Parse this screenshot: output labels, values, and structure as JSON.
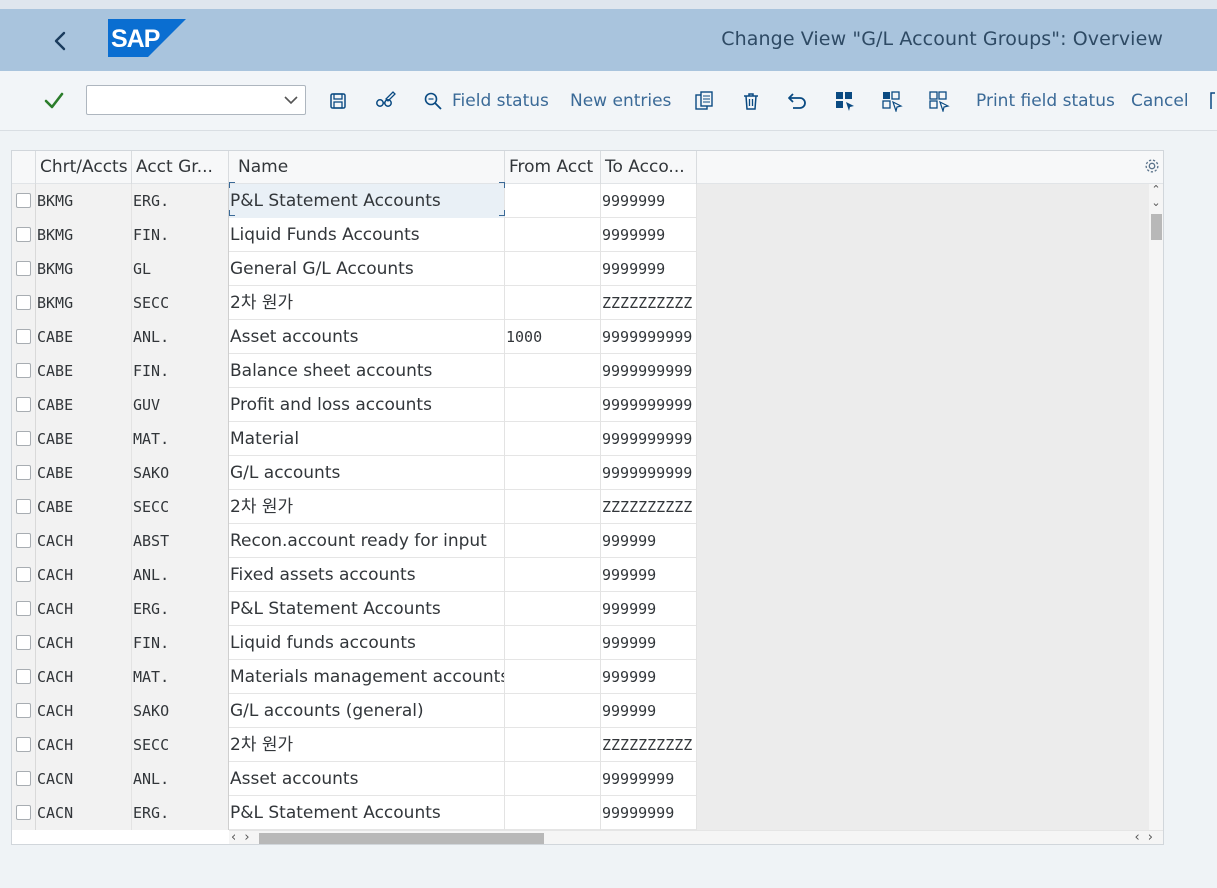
{
  "shell": {
    "title": "Change View \"G/L Account Groups\": Overview",
    "logo_text": "SAP",
    "brand_color": "#0a6ed1"
  },
  "toolbar": {
    "combo_value": "",
    "field_status_label": "Field status",
    "new_entries_label": "New entries",
    "print_field_status_label": "Print field status",
    "cancel_label": "Cancel"
  },
  "table": {
    "columns": [
      "Chrt/Accts",
      "Acct Gr...",
      "Name",
      "From Acct",
      "To Acco..."
    ],
    "rows": [
      {
        "chart": "BKMG",
        "group": "ERG.",
        "name": "P&L Statement Accounts",
        "from": "",
        "to": "9999999"
      },
      {
        "chart": "BKMG",
        "group": "FIN.",
        "name": "Liquid Funds Accounts",
        "from": "",
        "to": "9999999"
      },
      {
        "chart": "BKMG",
        "group": "GL",
        "name": "General G/L Accounts",
        "from": "",
        "to": "9999999"
      },
      {
        "chart": "BKMG",
        "group": "SECC",
        "name": "2차 원가",
        "from": "",
        "to": "ZZZZZZZZZZ"
      },
      {
        "chart": "CABE",
        "group": "ANL.",
        "name": "Asset accounts",
        "from": "1000",
        "to": "9999999999"
      },
      {
        "chart": "CABE",
        "group": "FIN.",
        "name": "Balance sheet accounts",
        "from": "",
        "to": "9999999999"
      },
      {
        "chart": "CABE",
        "group": "GUV",
        "name": "Profit and loss accounts",
        "from": "",
        "to": "9999999999"
      },
      {
        "chart": "CABE",
        "group": "MAT.",
        "name": "Material",
        "from": "",
        "to": "9999999999"
      },
      {
        "chart": "CABE",
        "group": "SAKO",
        "name": "G/L accounts",
        "from": "",
        "to": "9999999999"
      },
      {
        "chart": "CABE",
        "group": "SECC",
        "name": "2차 원가",
        "from": "",
        "to": "ZZZZZZZZZZ"
      },
      {
        "chart": "CACH",
        "group": "ABST",
        "name": "Recon.account ready for input",
        "from": "",
        "to": "999999"
      },
      {
        "chart": "CACH",
        "group": "ANL.",
        "name": "Fixed assets accounts",
        "from": "",
        "to": "999999"
      },
      {
        "chart": "CACH",
        "group": "ERG.",
        "name": "P&L Statement Accounts",
        "from": "",
        "to": "999999"
      },
      {
        "chart": "CACH",
        "group": "FIN.",
        "name": "Liquid funds accounts",
        "from": "",
        "to": "999999"
      },
      {
        "chart": "CACH",
        "group": "MAT.",
        "name": "Materials management accounts",
        "from": "",
        "to": "999999"
      },
      {
        "chart": "CACH",
        "group": "SAKO",
        "name": "G/L accounts (general)",
        "from": "",
        "to": "999999"
      },
      {
        "chart": "CACH",
        "group": "SECC",
        "name": "2차 원가",
        "from": "",
        "to": "ZZZZZZZZZZ"
      },
      {
        "chart": "CACN",
        "group": "ANL.",
        "name": "Asset accounts",
        "from": "",
        "to": "99999999"
      },
      {
        "chart": "CACN",
        "group": "ERG.",
        "name": "P&L Statement Accounts",
        "from": "",
        "to": "99999999"
      }
    ]
  }
}
